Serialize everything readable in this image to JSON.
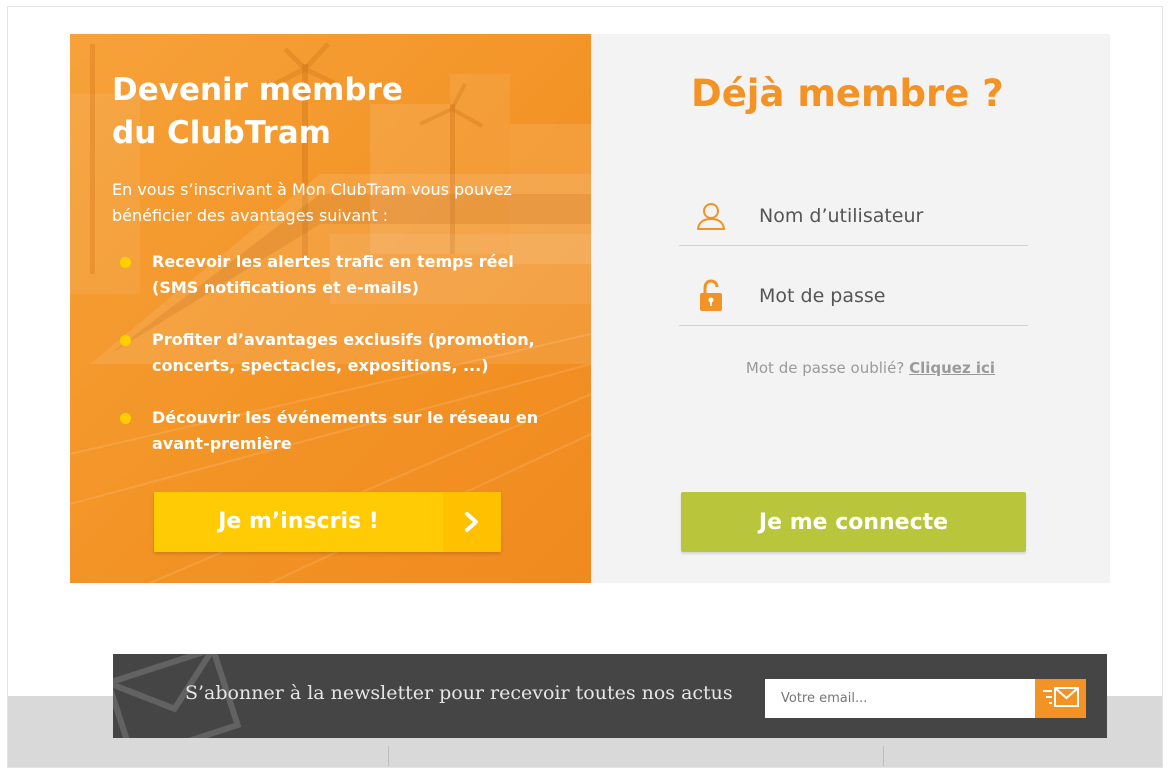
{
  "join": {
    "title_line1": "Devenir membre",
    "title_line2": "du ClubTram",
    "intro": "En vous s’inscrivant à Mon ClubTram vous pouvez bénéficier des avantages suivant :",
    "benefits": [
      {
        "line1": "Recevoir les alertes trafic en temps réel",
        "line2": "(SMS notifications et e-mails)"
      },
      {
        "line1": "Profiter d’avantages exclusifs (promotion,",
        "line2": "concerts, spectacles, expositions, ...)"
      },
      {
        "line1": "Découvrir les événements sur le réseau en",
        "line2": "avant-première"
      }
    ],
    "signup_label": "Je m’inscris !",
    "colors": {
      "panel": "#f39325",
      "button": "#ffcb05",
      "bullet": "#ffd000"
    }
  },
  "login": {
    "title": "Déjà membre ?",
    "username_placeholder": "Nom d’utilisateur",
    "password_placeholder": "Mot de passe",
    "forgot_text": "Mot de passe oublié?",
    "forgot_link": "Cliquez ici",
    "connect_label": "Je me connecte",
    "icons": {
      "username": "user-icon",
      "password": "lock-icon"
    },
    "colors": {
      "title": "#f39325",
      "button": "#b9c63b",
      "panel": "#f3f3f3"
    }
  },
  "newsletter": {
    "text": "S’abonner à la newsletter pour recevoir toutes nos actus",
    "email_placeholder": "Votre email...",
    "icons": {
      "background": "envelope-icon",
      "submit": "send-mail-icon"
    },
    "colors": {
      "bar": "#454545",
      "button": "#f39325"
    }
  }
}
